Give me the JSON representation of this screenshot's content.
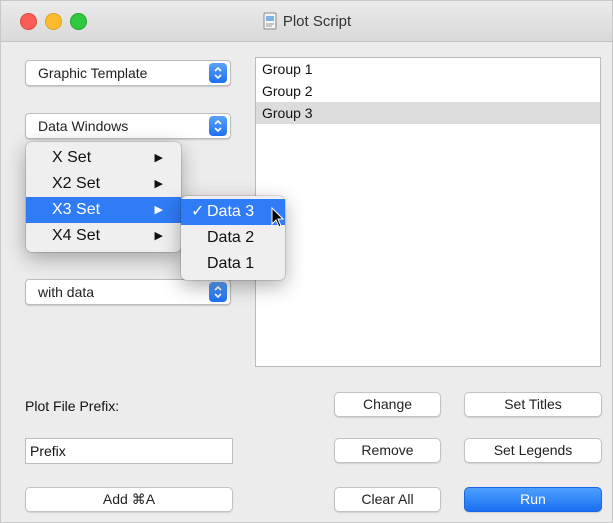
{
  "window": {
    "title": "Plot Script"
  },
  "popups": {
    "graphic_template": "Graphic Template",
    "data_windows": "Data Windows",
    "with_data": "with data"
  },
  "groups": [
    "Group 1",
    "Group 2",
    "Group 3"
  ],
  "selected_group": "Group 3",
  "menu": {
    "items": [
      {
        "label": "X Set",
        "arrow": "▶"
      },
      {
        "label": "X2 Set",
        "arrow": "▶"
      },
      {
        "label": "X3 Set",
        "arrow": "▶"
      },
      {
        "label": "X4 Set",
        "arrow": "▶"
      }
    ],
    "highlighted": "X3 Set"
  },
  "submenu": {
    "check": "✓",
    "items": [
      "Data 3",
      "Data 2",
      "Data 1"
    ],
    "checked": "Data 3"
  },
  "prefix": {
    "label": "Plot File Prefix:",
    "value": "Prefix"
  },
  "buttons": {
    "add": "Add ⌘A",
    "change": "Change",
    "remove": "Remove",
    "clear_all": "Clear All",
    "set_titles": "Set Titles",
    "set_legends": "Set Legends",
    "run": "Run"
  },
  "colors": {
    "accent": "#2f7cf6",
    "close": "#fc5c56",
    "minimize": "#fdbc2e",
    "zoom": "#30c83f"
  }
}
